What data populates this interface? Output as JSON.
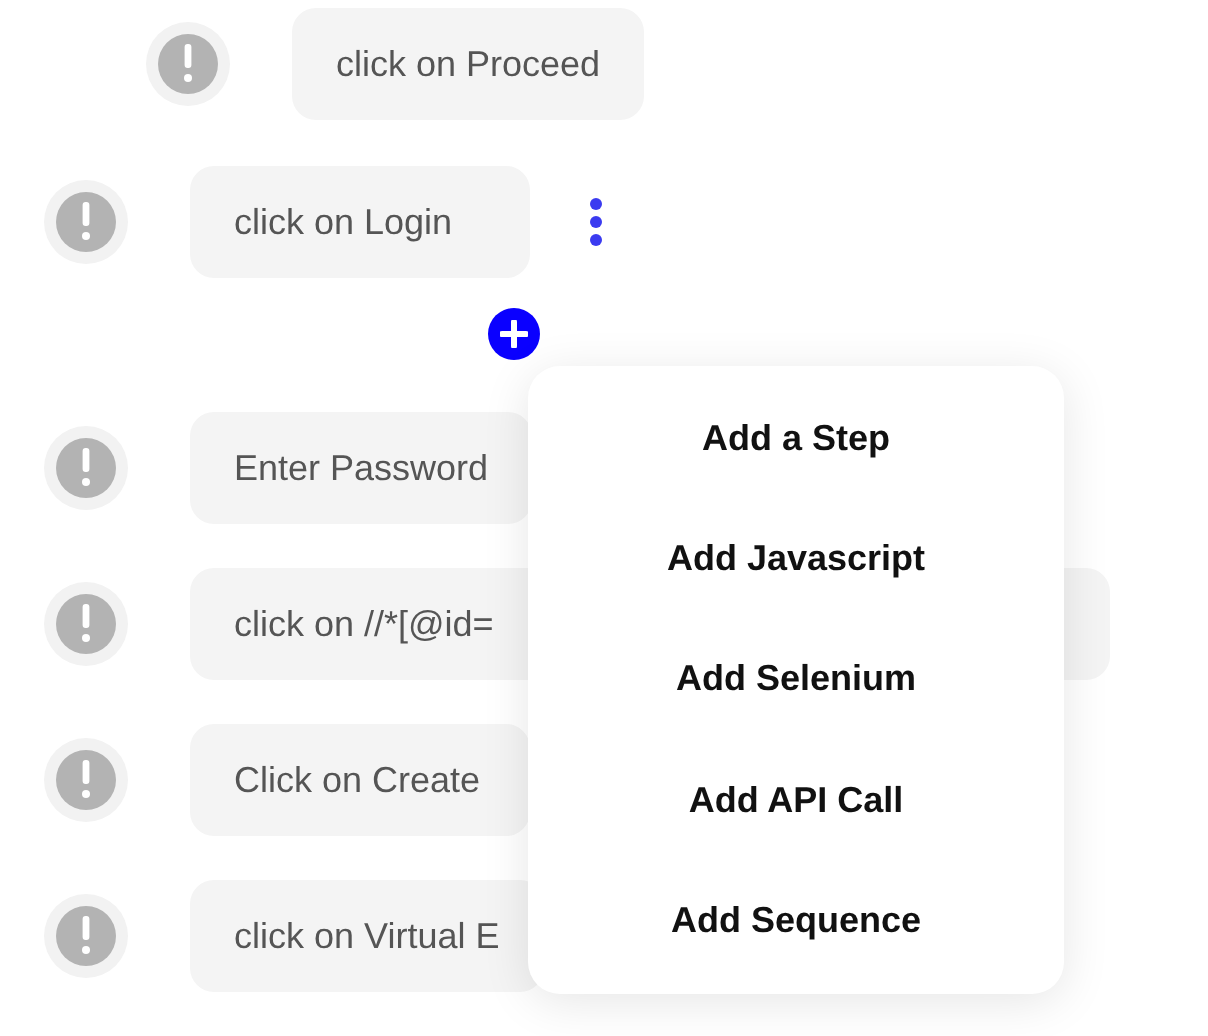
{
  "substeps": [
    {
      "label": "click on Proceed"
    }
  ],
  "steps": [
    {
      "label": "click on Login",
      "actions_visible": true
    },
    {
      "label": "Enter Password"
    },
    {
      "label": "click on //*[@id=",
      "wide": true
    },
    {
      "label": "Click on Create"
    },
    {
      "label": "click on Virtual E"
    }
  ],
  "add_menu": {
    "open": true,
    "items": [
      "Add a Step",
      "Add Javascript",
      "Add Selenium",
      "Add API Call",
      "Add Sequence"
    ]
  }
}
